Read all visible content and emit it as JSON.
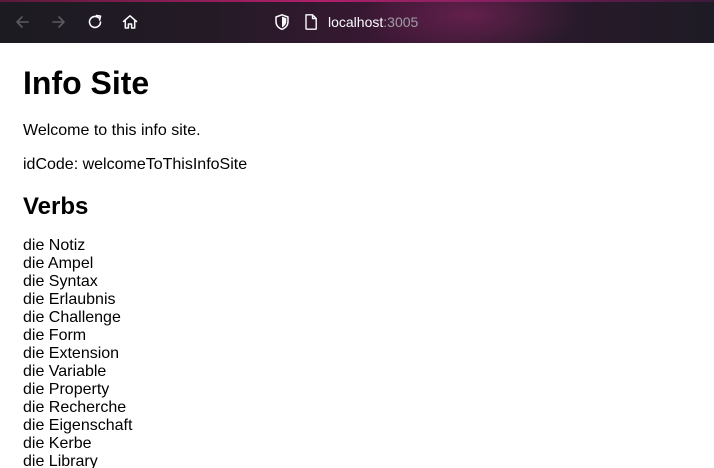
{
  "browser": {
    "url_host": "localhost",
    "url_port": ":3005",
    "icons": [
      "back-arrow-icon",
      "forward-arrow-icon",
      "reload-icon",
      "home-icon",
      "shield-icon",
      "page-icon"
    ]
  },
  "page": {
    "title": "Info Site",
    "welcome": "Welcome to this info site.",
    "id_code": "idCode: welcomeToThisInfoSite",
    "verbs_heading": "Verbs",
    "verbs": [
      "die Notiz",
      "die Ampel",
      "die Syntax",
      "die Erlaubnis",
      "die Challenge",
      "die Form",
      "die Extension",
      "die Variable",
      "die Property",
      "die Recherche",
      "die Eigenschaft",
      "die Kerbe",
      "die Library"
    ]
  }
}
